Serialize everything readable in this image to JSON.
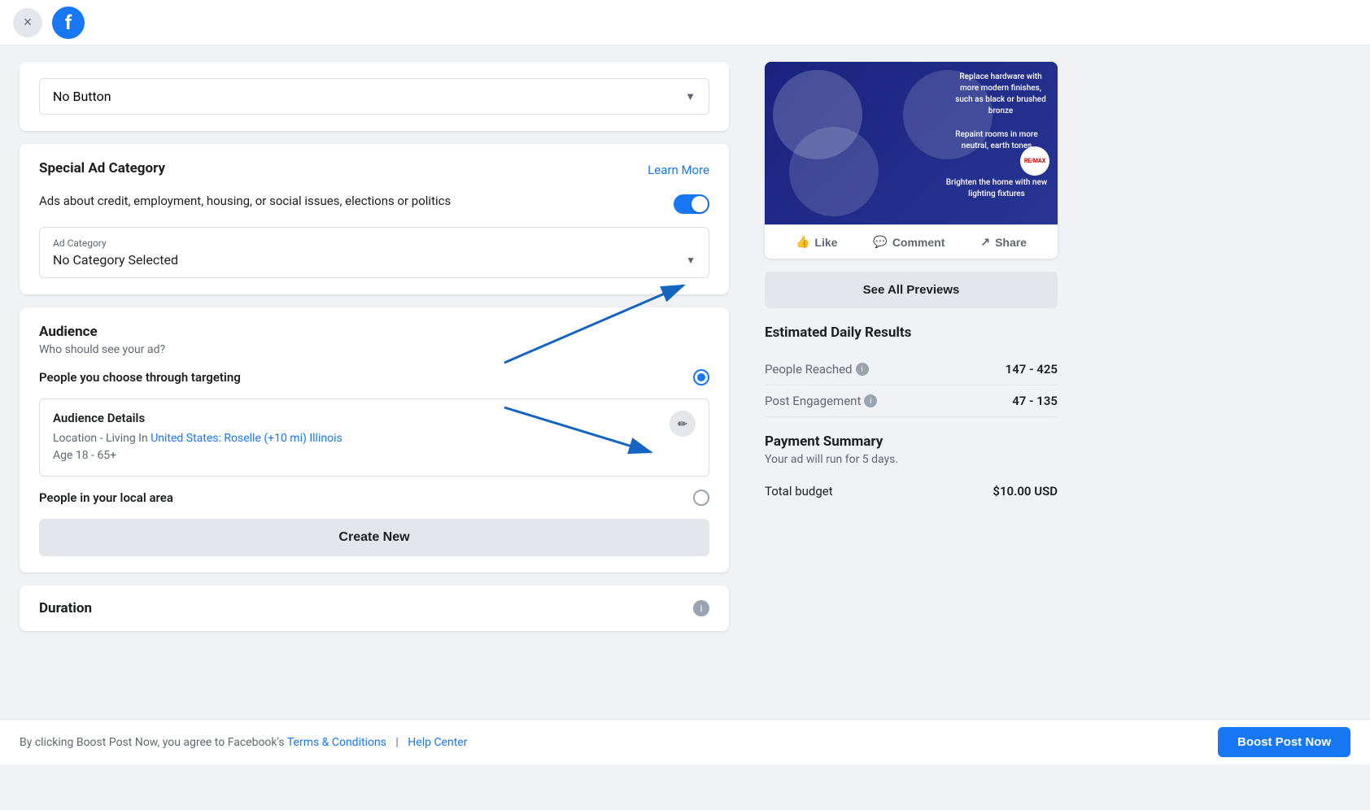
{
  "header": {
    "close_label": "×",
    "fb_letter": "f"
  },
  "no_button_section": {
    "dropdown_value": "No Button",
    "dropdown_chevron": "▼"
  },
  "special_ad": {
    "title": "Special Ad Category",
    "learn_more": "Learn More",
    "toggle_text": "Ads about credit, employment, housing, or social issues, elections or politics",
    "toggle_on": true,
    "ad_category_label": "Ad Category",
    "ad_category_value": "No Category Selected",
    "chevron": "▼"
  },
  "audience": {
    "title": "Audience",
    "subtitle": "Who should see your ad?",
    "option1_label": "People you choose through targeting",
    "option1_selected": true,
    "details_title": "Audience Details",
    "details_location": "Location - Living In",
    "details_location_link": "United States: Roselle (+10 mi) Illinois",
    "details_age": "Age 18 - 65+",
    "option2_label": "People in your local area",
    "option2_selected": false,
    "create_new_label": "Create New"
  },
  "duration": {
    "title": "Duration"
  },
  "ad_preview": {
    "text1": "Replace hardware with more modern finishes, such as black or brushed bronze",
    "text2": "Repaint rooms in more neutral, earth tones",
    "text3": "Brighten the home with new lighting fixtures",
    "remax_label": "RE/MAX",
    "like_label": "Like",
    "comment_label": "Comment",
    "share_label": "Share",
    "see_all_label": "See All Previews"
  },
  "estimated": {
    "title": "Estimated Daily Results",
    "people_reached_label": "People Reached",
    "people_reached_value": "147 - 425",
    "post_engagement_label": "Post Engagement",
    "post_engagement_value": "47 - 135"
  },
  "payment": {
    "title": "Payment Summary",
    "subtitle": "Your ad will run for 5 days.",
    "total_label": "Total budget",
    "total_value": "$10.00 USD"
  },
  "footer": {
    "text_before": "By clicking Boost Post Now, you agree to Facebook's",
    "terms_label": "Terms & Conditions",
    "separator": "|",
    "help_label": "Help Center",
    "boost_label": "Boost Post Now"
  }
}
